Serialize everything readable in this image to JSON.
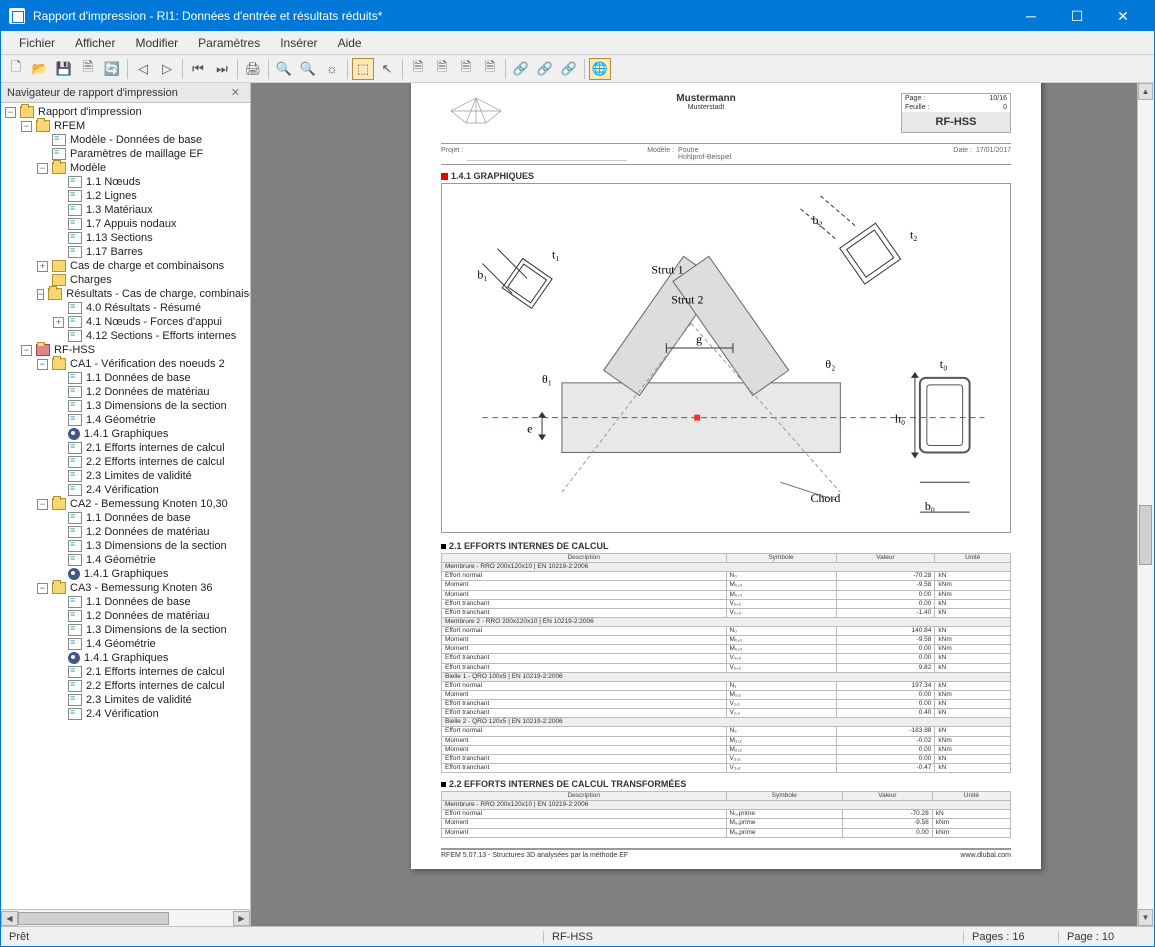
{
  "window": {
    "title": "Rapport d'impression - RI1: Données d'entrée et résultats réduits*"
  },
  "menu": [
    "Fichier",
    "Afficher",
    "Modifier",
    "Paramètres",
    "Insérer",
    "Aide"
  ],
  "sidebar": {
    "title": "Navigateur de rapport d'impression"
  },
  "tree": {
    "root": "Rapport d'impression",
    "rfem": "RFEM",
    "rfem_items": [
      "Modèle - Données de base",
      "Paramètres de maillage EF"
    ],
    "modele": "Modèle",
    "modele_items": [
      "1.1 Nœuds",
      "1.2 Lignes",
      "1.3 Matériaux",
      "1.7 Appuis nodaux",
      "1.13 Sections",
      "1.17 Barres"
    ],
    "cas": "Cas de charge et combinaisons",
    "charges": "Charges",
    "resultats": "Résultats - Cas de charge, combinaisons",
    "resultats_items": [
      "4.0 Résultats - Résumé",
      "4.1 Nœuds - Forces d'appui",
      "4.12 Sections - Efforts internes"
    ],
    "rfhss": "RF-HSS",
    "ca1": "CA1 - Vérification des noeuds 2",
    "ca1_items": [
      "1.1 Données de base",
      "1.2 Données de matériau",
      "1.3 Dimensions de la section",
      "1.4 Géométrie",
      "1.4.1 Graphiques",
      "2.1 Efforts internes de calcul",
      "2.2 Efforts internes de calcul",
      "2.3 Limites de validité",
      "2.4 Vérification"
    ],
    "ca2": "CA2 - Bemessung Knoten 10,30",
    "ca2_items": [
      "1.1 Données de base",
      "1.2 Données de matériau",
      "1.3 Dimensions de la section",
      "1.4 Géométrie",
      "1.4.1 Graphiques"
    ],
    "ca3": "CA3 - Bemessung Knoten 36",
    "ca3_items": [
      "1.1 Données de base",
      "1.2 Données de matériau",
      "1.3 Dimensions de la section",
      "1.4 Géométrie",
      "1.4.1 Graphiques",
      "2.1 Efforts internes de calcul",
      "2.2 Efforts internes de calcul",
      "2.3 Limites de validité",
      "2.4 Vérification"
    ]
  },
  "page": {
    "company": "Mustermann",
    "city": "Musterstadt",
    "page_label": "Page :",
    "page_val": "10/16",
    "feuille_label": "Feuille :",
    "feuille_val": "0",
    "module": "RF-HSS",
    "projet_label": "Projet :",
    "projet_val": "",
    "modele_label": "Modèle :",
    "modele_val": "Poutre",
    "modele_val2": "Hohlprof-Beispiel",
    "date_label": "Date :",
    "date_val": "17/01/2017",
    "sec141": "1.4.1 GRAPHIQUES",
    "sec21": "2.1 EFFORTS INTERNES DE CALCUL",
    "sec22": "2.2 EFFORTS INTERNES DE CALCUL TRANSFORMÉES",
    "footer_left": "RFEM 5.07.13 - Structures 3D analysées par la méthode EF",
    "footer_right": "www.dlubal.com",
    "diagram_labels": {
      "b1": "b₁",
      "t1": "t₁",
      "s1": "Strut 1",
      "s2": "Strut 2",
      "g": "g",
      "th1": "θ₁",
      "th2": "θ₂",
      "e": "e",
      "b2": "b₂",
      "t2": "t₂",
      "t0": "t₀",
      "h0": "h₀",
      "b0": "b₀",
      "chord": "Chord"
    }
  },
  "table_headers": [
    "Description",
    "Symbole",
    "Valeur",
    "Unité"
  ],
  "table21": {
    "groups": [
      {
        "title": "Membrure - RRO 200x120x10 | EN 10219-2:2006",
        "rows": [
          [
            "Effort normal",
            "N₀",
            "-70.28",
            "kN"
          ],
          [
            "Moment",
            "M₀,₀",
            "-9.58",
            "kNm"
          ],
          [
            "Moment",
            "M₀,₀",
            "0.00",
            "kNm"
          ],
          [
            "Effort tranchant",
            "V₀,₀",
            "0.00",
            "kN"
          ],
          [
            "Effort tranchant",
            "V₀,₀",
            "-1.40",
            "kN"
          ]
        ]
      },
      {
        "title": "Membrure 2 - RRO 200x120x10 | EN 10219-2:2006",
        "rows": [
          [
            "Effort normal",
            "N₀",
            "140.84",
            "kN"
          ],
          [
            "Moment",
            "M₀,₀",
            "-9.58",
            "kNm"
          ],
          [
            "Moment",
            "M₀,₀",
            "0.00",
            "kNm"
          ],
          [
            "Effort tranchant",
            "V₀,₀",
            "0.00",
            "kN"
          ],
          [
            "Effort tranchant",
            "V₀,₀",
            "9.82",
            "kN"
          ]
        ]
      },
      {
        "title": "Bielle 1 - QRO 100x5 | EN 10219-2:2006",
        "rows": [
          [
            "Effort normal",
            "N₁",
            "197.34",
            "kN"
          ],
          [
            "Moment",
            "M₁,₁",
            "0.00",
            "kNm"
          ],
          [
            "Effort tranchant",
            "V₁,₁",
            "0.00",
            "kN"
          ],
          [
            "Effort tranchant",
            "V₁,₁",
            "0.40",
            "kN"
          ]
        ]
      },
      {
        "title": "Bielle 2 - QRO 120x5 | EN 10219-2:2006",
        "rows": [
          [
            "Effort normal",
            "N₂",
            "-183.88",
            "kN"
          ],
          [
            "Moment",
            "M₂,₂",
            "-0.02",
            "kNm"
          ],
          [
            "Moment",
            "M₂,₂",
            "0.00",
            "kNm"
          ],
          [
            "Effort tranchant",
            "V₂,₂",
            "0.00",
            "kN"
          ],
          [
            "Effort tranchant",
            "V₂,₂",
            "-0.47",
            "kN"
          ]
        ]
      }
    ]
  },
  "table22": {
    "groups": [
      {
        "title": "Membrure - RRO 200x120x10 | EN 10219-2:2006",
        "rows": [
          [
            "Effort normal",
            "N₀,prime",
            "-70.28",
            "kN"
          ],
          [
            "Moment",
            "M₉,prime",
            "-9.58",
            "kNm"
          ],
          [
            "Moment",
            "M₉,prime",
            "0.00",
            "kNm"
          ]
        ]
      }
    ]
  },
  "status": {
    "ready": "Prêt",
    "module": "RF-HSS",
    "pages_label": "Pages :",
    "pages_val": "16",
    "page_label": "Page :",
    "page_val": "10"
  }
}
